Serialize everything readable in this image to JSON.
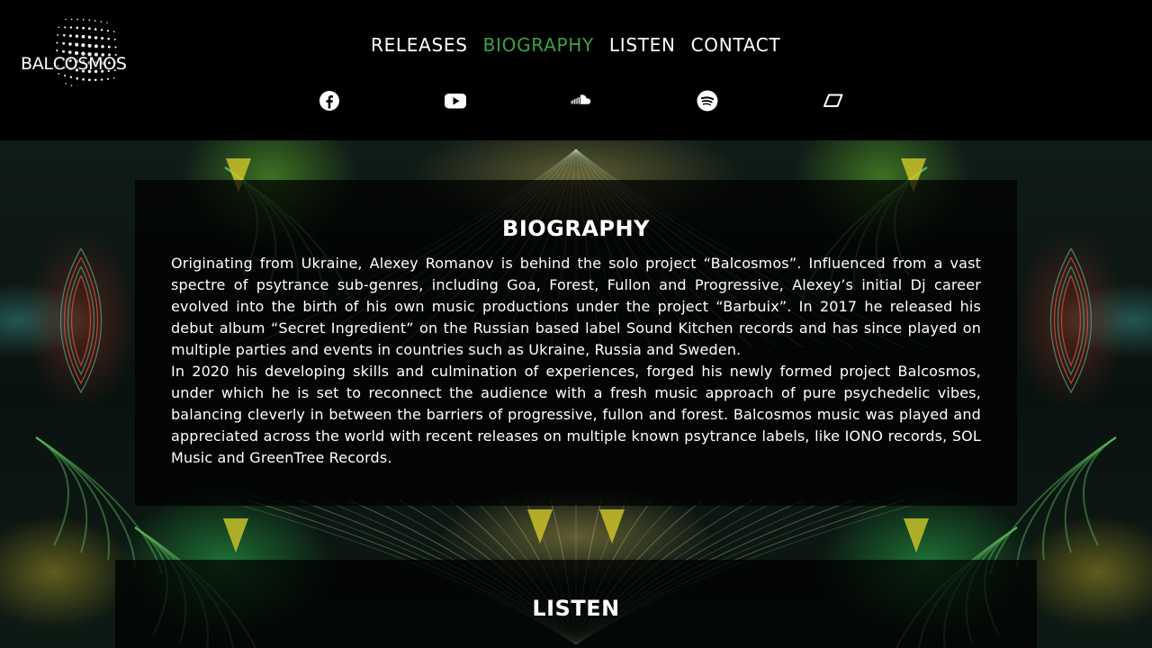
{
  "header": {
    "logo_text": "BALCOSMOS",
    "nav": [
      {
        "label": "RELEASES",
        "active": false
      },
      {
        "label": "BIOGRAPHY",
        "active": true
      },
      {
        "label": "LISTEN",
        "active": false
      },
      {
        "label": "CONTACT",
        "active": false
      }
    ],
    "socials": [
      {
        "icon": "facebook-icon"
      },
      {
        "icon": "youtube-icon"
      },
      {
        "icon": "soundcloud-icon"
      },
      {
        "icon": "spotify-icon"
      },
      {
        "icon": "beatport-icon"
      }
    ],
    "active_color": "#3aa046"
  },
  "biography": {
    "title": "BIOGRAPHY",
    "paragraphs": [
      "Originating from Ukraine, Alexey Romanov is behind the solo project “Balcosmos”. Influenced from a vast spectre of psytrance sub-genres, including Goa, Forest, Fullon and Progressive, Alexey’s initial Dj career evolved into the birth of his own music productions under the project “Barbuix”. In 2017 he released his debut album “Secret Ingredient” on the Russian based label Sound Kitchen records and has since played on multiple parties and events in countries such as Ukraine, Russia and Sweden.",
      "In 2020 his developing skills and culmination of experiences, forged his newly formed project Balcosmos, under which he is set to reconnect the audience with a fresh music approach of pure psychedelic vibes, balancing cleverly in between the barriers of progressive, fullon and forest. Balcosmos music was played and appreciated across the world with recent releases on multiple known psytrance labels, like IONO records, SOL Music and GreenTree Records."
    ]
  },
  "listen": {
    "title": "LISTEN"
  }
}
